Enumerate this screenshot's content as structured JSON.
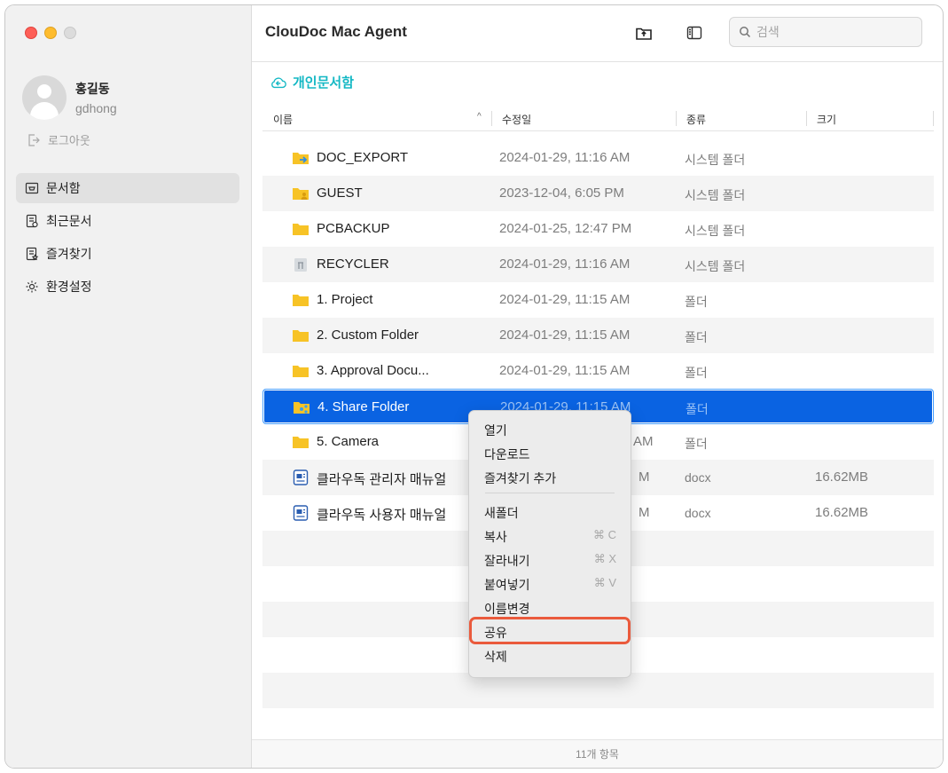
{
  "app": {
    "title": "ClouDoc Mac Agent"
  },
  "user": {
    "name": "홍길동",
    "id": "gdhong",
    "logout_label": "로그아웃"
  },
  "nav": [
    {
      "label": "문서함",
      "icon": "inbox-icon",
      "active": true
    },
    {
      "label": "최근문서",
      "icon": "recent-docs-icon",
      "active": false
    },
    {
      "label": "즐겨찾기",
      "icon": "favorites-icon",
      "active": false
    },
    {
      "label": "환경설정",
      "icon": "gear-icon",
      "active": false
    }
  ],
  "search": {
    "placeholder": "검색",
    "value": ""
  },
  "breadcrumb": {
    "label": "개인문서함",
    "icon": "cloud-icon"
  },
  "columns": {
    "name": "이름",
    "modified": "수정일",
    "kind": "종류",
    "size": "크기",
    "sort": "^"
  },
  "rows": [
    {
      "name": "DOC_EXPORT",
      "date": "2024-01-29, 11:16 AM",
      "kind": "시스템 폴더",
      "size": "",
      "icon": "export-folder-icon"
    },
    {
      "name": "GUEST",
      "date": "2023-12-04, 6:05 PM",
      "kind": "시스템 폴더",
      "size": "",
      "icon": "guest-folder-icon"
    },
    {
      "name": "PCBACKUP",
      "date": "2024-01-25, 12:47 PM",
      "kind": "시스템 폴더",
      "size": "",
      "icon": "folder-icon"
    },
    {
      "name": "RECYCLER",
      "date": "2024-01-29, 11:16 AM",
      "kind": "시스템 폴더",
      "size": "",
      "icon": "recycle-bin-icon"
    },
    {
      "name": "1. Project",
      "date": "2024-01-29, 11:15 AM",
      "kind": "폴더",
      "size": "",
      "icon": "folder-icon"
    },
    {
      "name": "2. Custom Folder",
      "date": "2024-01-29, 11:15 AM",
      "kind": "폴더",
      "size": "",
      "icon": "folder-icon"
    },
    {
      "name": "3. Approval Docu...",
      "date": "2024-01-29, 11:15 AM",
      "kind": "폴더",
      "size": "",
      "icon": "folder-icon"
    },
    {
      "name": "4. Share Folder",
      "date": "2024-01-29, 11:15 AM",
      "kind": "폴더",
      "size": "",
      "icon": "shared-folder-icon",
      "selected": true
    },
    {
      "name": "5. Camera",
      "date": "AM",
      "kind": "폴더",
      "size": "",
      "icon": "folder-icon"
    },
    {
      "name": "클라우독 관리자 매뉴얼",
      "date": "M",
      "kind": "docx",
      "size": "16.62MB",
      "icon": "docx-file-icon"
    },
    {
      "name": "클라우독 사용자 매뉴얼",
      "date": "M",
      "kind": "docx",
      "size": "16.62MB",
      "icon": "docx-file-icon"
    }
  ],
  "footer": {
    "count": "11개 항목"
  },
  "context_menu": {
    "items": [
      {
        "label": "열기",
        "shortcut": ""
      },
      {
        "label": "다운로드",
        "shortcut": ""
      },
      {
        "label": "즐겨찾기 추가",
        "shortcut": ""
      },
      {
        "separator": true
      },
      {
        "label": "새폴더",
        "shortcut": ""
      },
      {
        "label": "복사",
        "shortcut": "⌘ C"
      },
      {
        "label": "잘라내기",
        "shortcut": "⌘ X"
      },
      {
        "label": "붙여넣기",
        "shortcut": "⌘ V"
      },
      {
        "label": "이름변경",
        "shortcut": ""
      },
      {
        "label": "공유",
        "shortcut": "",
        "highlight": true
      },
      {
        "label": "삭제",
        "shortcut": ""
      }
    ]
  },
  "colors": {
    "accent": "#0a63e2",
    "breadcrumb": "#14b8c4",
    "folder": "#f7c326",
    "highlight_border": "#ea5a3c"
  }
}
